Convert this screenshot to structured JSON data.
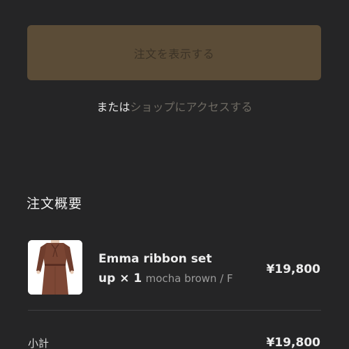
{
  "order_button": {
    "label": "注文を表示する"
  },
  "alt_line": {
    "prefix": "または",
    "link_text": "ショップにアクセスする"
  },
  "summary": {
    "title": "注文概要",
    "item": {
      "name": "Emma ribbon set",
      "quantity_text": "up × 1",
      "variant": "mocha brown / F",
      "price": "¥19,800",
      "image": "dress-thumbnail"
    },
    "subtotal_label": "小計",
    "subtotal_value": "¥19,800"
  },
  "colors": {
    "background": "#252526",
    "button": "#5b4c37",
    "button_text": "#3b3226",
    "link": "#6f6b63",
    "dress": "#7a4533"
  }
}
